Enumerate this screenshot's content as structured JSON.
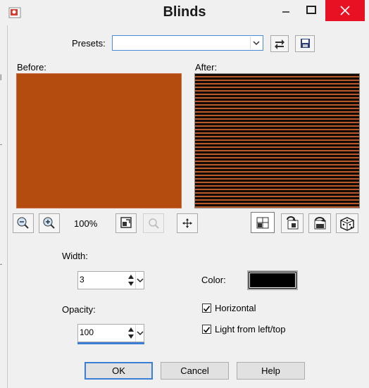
{
  "window": {
    "title": "Blinds",
    "icons": [
      "app-icon",
      "minimize-icon",
      "maximize-icon",
      "close-icon"
    ]
  },
  "presets": {
    "label": "Presets:",
    "value": "",
    "icons": [
      "preset-load-icon",
      "preset-save-icon"
    ]
  },
  "preview": {
    "before_label": "Before:",
    "after_label": "After:",
    "before_color": "#b44c0f",
    "after_line_color": "#150b06",
    "zoom_level": "100%",
    "icons": [
      "zoom-out-icon",
      "zoom-in-icon",
      "zoom-fit-icon",
      "navigate-icon",
      "pan-icon",
      "proof-icon",
      "reset-icon",
      "reset-default-icon",
      "randomize-icon"
    ]
  },
  "settings": {
    "width_label": "Width:",
    "width_value": "3",
    "opacity_label": "Opacity:",
    "opacity_value": "100",
    "color_label": "Color:",
    "color_value": "#000000",
    "horizontal_label": "Horizontal",
    "horizontal_checked": true,
    "light_label": "Light from left/top",
    "light_checked": true
  },
  "buttons": {
    "ok": "OK",
    "cancel": "Cancel",
    "help": "Help"
  }
}
